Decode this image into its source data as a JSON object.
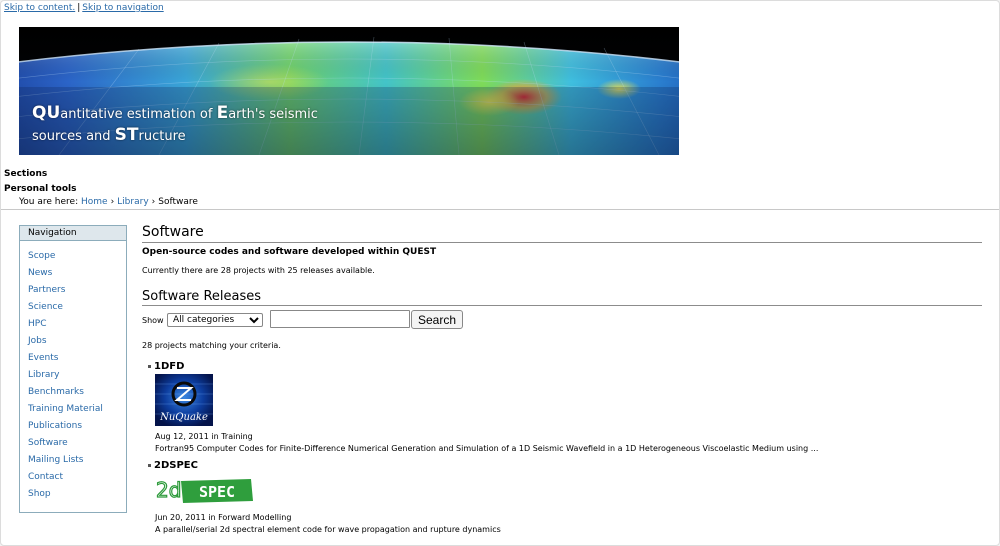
{
  "skip_links": {
    "content": "Skip to content.",
    "separator": "|",
    "navigation": "Skip to navigation"
  },
  "banner": {
    "line1_cap1": "QU",
    "line1_rest1": "antitative estimation of ",
    "line1_cap2": "E",
    "line1_rest2": "arth's seismic",
    "line2_start": "sources and ",
    "line2_cap": "ST",
    "line2_rest": "ructure"
  },
  "portal": {
    "sections": "Sections",
    "personal_tools": "Personal tools"
  },
  "breadcrumb": {
    "prefix": "You are here:",
    "home": "Home",
    "library": "Library",
    "current": "Software",
    "separator": "›"
  },
  "navigation": {
    "title": "Navigation",
    "items": [
      "Scope",
      "News",
      "Partners",
      "Science",
      "HPC",
      "Jobs",
      "Events",
      "Library",
      "Benchmarks",
      "Training Material",
      "Publications",
      "Software",
      "Mailing Lists",
      "Contact",
      "Shop"
    ]
  },
  "main": {
    "title": "Software",
    "description": "Open-source codes and software developed within QUEST",
    "summary": "Currently there are 28 projects with 25 releases available.",
    "releases_title": "Software Releases",
    "filter": {
      "show_label": "Show",
      "category_selected": "All categories",
      "search_value": "",
      "search_button": "Search"
    },
    "matching": "28 projects matching your criteria.",
    "projects": [
      {
        "title": "1DFD",
        "logo_text": "NuQuake",
        "date": "Aug 12, 2011",
        "in": "in",
        "category": "Training",
        "description": "Fortran95 Computer Codes for Finite-Difference Numerical Generation and Simulation of a 1D Seismic Wavefield in a 1D Heterogeneous Viscoelastic Medium using ..."
      },
      {
        "title": "2DSPEC",
        "logo_text": "SPEC",
        "logo_prefix": "2d",
        "date": "Jun 20, 2011",
        "in": "in",
        "category": "Forward Modelling",
        "description": "A parallel/serial 2d spectral element code for wave propagation and rupture dynamics"
      }
    ]
  },
  "colors": {
    "link": "#2a6aa8",
    "nav_header_bg": "#dee7ec",
    "nav_border": "#8cacbb"
  }
}
